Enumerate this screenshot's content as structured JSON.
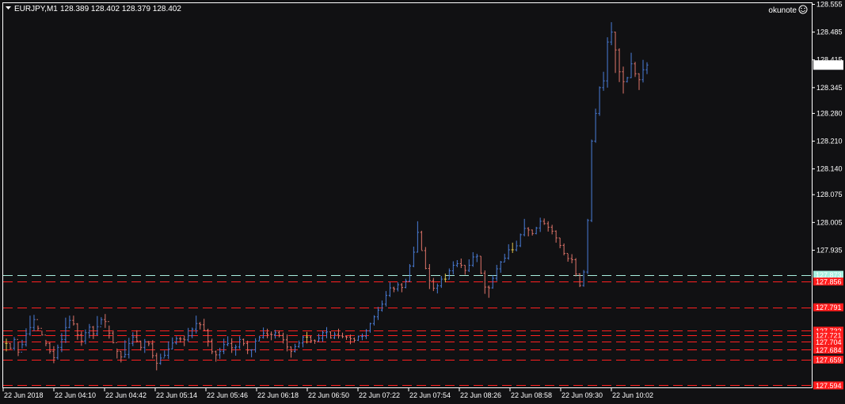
{
  "header": {
    "symbol_label": "EURJPY,M1",
    "ohlc_label": "128.389 128.402 128.379 128.402",
    "watermark": "okunote"
  },
  "colors": {
    "background": "#111113",
    "frame": "#ffffff",
    "bull": "#4a7dd8",
    "bear": "#e0756a",
    "doji": "#e0c24a",
    "level_line": "#ff2020",
    "current_line": "#a8f0e0",
    "level_label_bg": "#ff1c1c",
    "current_label_bg": "#a8f0e0",
    "price_label_bg": "#ffffff"
  },
  "chart_data": {
    "type": "candlestick",
    "symbol": "EURJPY",
    "timeframe": "M1",
    "y_range": [
      127.589,
      128.558
    ],
    "y_ticks": [
      "128.555",
      "128.485",
      "128.415",
      "128.345",
      "128.280",
      "128.210",
      "128.140",
      "128.075",
      "128.005",
      "127.935"
    ],
    "x_ticks": [
      "22 Jun 2018",
      "22 Jun 04:10",
      "22 Jun 04:42",
      "22 Jun 05:14",
      "22 Jun 05:46",
      "22 Jun 06:18",
      "22 Jun 06:50",
      "22 Jun 07:22",
      "22 Jun 07:54",
      "22 Jun 08:26",
      "22 Jun 08:58",
      "22 Jun 09:30",
      "22 Jun 10:02"
    ],
    "current_price": "128.402",
    "levels": [
      {
        "price": 127.873,
        "label": "127.873",
        "style": "current"
      },
      {
        "price": 127.856,
        "label": "127.856",
        "style": "level"
      },
      {
        "price": 127.791,
        "label": "127.791",
        "style": "level"
      },
      {
        "price": 127.732,
        "label": "127.732",
        "style": "level"
      },
      {
        "price": 127.721,
        "label": "127.721",
        "style": "level"
      },
      {
        "price": 127.704,
        "label": "127.704",
        "style": "level"
      },
      {
        "price": 127.684,
        "label": "127.684",
        "style": "level"
      },
      {
        "price": 127.659,
        "label": "127.659",
        "style": "level"
      },
      {
        "price": 127.594,
        "label": "127.594",
        "style": "level"
      }
    ],
    "closes": [
      127.7,
      127.688,
      127.71,
      127.678,
      127.697,
      127.724,
      127.74,
      127.76,
      127.738,
      127.721,
      127.7,
      127.68,
      127.664,
      127.69,
      127.71,
      127.74,
      127.758,
      127.749,
      127.722,
      127.706,
      127.727,
      127.741,
      127.724,
      127.742,
      127.76,
      127.755,
      127.726,
      127.702,
      127.68,
      127.666,
      127.672,
      127.7,
      127.716,
      127.706,
      127.69,
      127.704,
      127.699,
      127.669,
      127.65,
      127.663,
      127.67,
      127.686,
      127.701,
      127.712,
      127.711,
      127.709,
      127.719,
      127.736,
      127.75,
      127.747,
      127.733,
      127.706,
      127.679,
      127.671,
      127.68,
      127.697,
      127.7,
      127.689,
      127.691,
      127.71,
      127.7,
      127.683,
      127.684,
      127.706,
      127.715,
      127.726,
      127.723,
      127.722,
      127.727,
      127.72,
      127.709,
      127.691,
      127.68,
      127.692,
      127.701,
      127.716,
      127.716,
      127.707,
      127.706,
      127.713,
      127.727,
      127.729,
      127.714,
      127.723,
      127.719,
      127.717,
      127.716,
      127.712,
      127.708,
      127.717,
      127.718,
      127.732,
      127.75,
      127.767,
      127.784,
      127.799,
      127.821,
      127.84,
      127.837,
      127.848,
      127.841,
      127.857,
      127.895,
      127.93,
      127.98,
      127.934,
      127.889,
      127.858,
      127.839,
      127.845,
      127.862,
      127.862,
      127.883,
      127.897,
      127.901,
      127.897,
      127.884,
      127.897,
      127.918,
      127.92,
      127.877,
      127.842,
      127.84,
      127.864,
      127.888,
      127.905,
      127.915,
      127.936,
      127.936,
      127.946,
      127.974,
      127.99,
      127.986,
      127.977,
      127.991,
      128.008,
      128.002,
      127.993,
      127.983,
      127.966,
      127.947,
      127.927,
      127.914,
      127.911,
      127.875,
      127.846,
      127.88,
      128.01,
      128.21,
      128.28,
      128.345,
      128.362,
      128.46,
      128.485,
      128.44,
      128.385,
      128.36,
      128.37,
      128.405,
      128.38,
      128.365,
      128.39,
      128.402
    ],
    "highs": [
      127.712,
      127.701,
      127.716,
      127.703,
      127.709,
      127.738,
      127.77,
      127.772,
      127.745,
      127.732,
      127.709,
      127.703,
      127.693,
      127.697,
      127.726,
      127.765,
      127.77,
      127.77,
      127.751,
      127.73,
      127.735,
      127.749,
      127.744,
      127.769,
      127.766,
      127.774,
      127.745,
      127.733,
      127.687,
      127.68,
      127.708,
      127.714,
      127.728,
      127.733,
      127.706,
      127.711,
      127.706,
      127.708,
      127.676,
      127.674,
      127.682,
      127.705,
      127.715,
      127.718,
      127.717,
      127.72,
      127.739,
      127.74,
      127.77,
      127.754,
      127.762,
      127.737,
      127.712,
      127.682,
      127.689,
      127.712,
      127.718,
      127.713,
      127.697,
      127.718,
      127.712,
      127.707,
      127.685,
      127.713,
      127.719,
      127.74,
      127.737,
      127.73,
      127.734,
      127.732,
      127.727,
      127.722,
      127.692,
      127.699,
      127.707,
      127.719,
      127.729,
      127.719,
      127.71,
      127.724,
      127.732,
      127.741,
      127.73,
      127.729,
      127.737,
      127.727,
      127.719,
      127.722,
      127.715,
      127.72,
      127.725,
      127.736,
      127.752,
      127.771,
      127.792,
      127.808,
      127.832,
      127.854,
      127.843,
      127.854,
      127.852,
      127.863,
      127.9,
      127.944,
      128.008,
      127.984,
      127.943,
      127.9,
      127.865,
      127.851,
      127.87,
      127.876,
      127.889,
      127.907,
      127.91,
      127.914,
      127.897,
      127.912,
      127.93,
      127.926,
      127.92,
      127.884,
      127.846,
      127.872,
      127.898,
      127.908,
      127.926,
      127.95,
      127.954,
      127.959,
      127.977,
      128.014,
      127.993,
      127.987,
      127.994,
      128.017,
      128.015,
      128.008,
      127.999,
      127.985,
      127.966,
      127.952,
      127.926,
      127.925,
      127.915,
      127.877,
      127.885,
      128.014,
      128.214,
      128.292,
      128.348,
      128.385,
      128.472,
      128.51,
      128.486,
      128.444,
      128.398,
      128.372,
      128.433,
      128.41,
      128.381,
      128.415,
      128.409
    ],
    "lows": [
      127.68,
      127.685,
      127.682,
      127.668,
      127.687,
      127.692,
      127.719,
      127.731,
      127.732,
      127.72,
      127.693,
      127.674,
      127.65,
      127.659,
      127.678,
      127.701,
      127.738,
      127.745,
      127.709,
      127.694,
      127.698,
      127.713,
      127.711,
      127.72,
      127.747,
      127.739,
      127.712,
      127.7,
      127.662,
      127.652,
      127.664,
      127.662,
      127.693,
      127.702,
      127.682,
      127.676,
      127.693,
      127.662,
      127.632,
      127.646,
      127.665,
      127.661,
      127.685,
      127.697,
      127.702,
      127.693,
      127.704,
      127.713,
      127.725,
      127.735,
      127.733,
      127.692,
      127.673,
      127.654,
      127.661,
      127.673,
      127.693,
      127.676,
      127.669,
      127.686,
      127.694,
      127.673,
      127.665,
      127.677,
      127.706,
      127.712,
      127.713,
      127.708,
      127.712,
      127.715,
      127.7,
      127.68,
      127.664,
      127.677,
      127.689,
      127.69,
      127.7,
      127.701,
      127.699,
      127.704,
      127.704,
      127.713,
      127.712,
      127.711,
      127.712,
      127.713,
      127.709,
      127.698,
      127.702,
      127.706,
      127.708,
      127.711,
      127.727,
      127.745,
      127.759,
      127.78,
      127.793,
      127.817,
      127.829,
      127.831,
      127.829,
      127.839,
      127.855,
      127.892,
      127.929,
      127.935,
      127.887,
      127.837,
      127.832,
      127.826,
      127.84,
      127.854,
      127.861,
      127.874,
      127.892,
      127.89,
      127.873,
      127.88,
      127.893,
      127.905,
      127.875,
      127.825,
      127.815,
      127.838,
      127.857,
      127.878,
      127.905,
      127.911,
      127.928,
      127.932,
      127.943,
      127.97,
      127.97,
      127.972,
      127.975,
      127.981,
      127.999,
      127.982,
      127.975,
      127.954,
      127.94,
      127.922,
      127.906,
      127.902,
      127.869,
      127.842,
      127.843,
      127.875,
      128.006,
      128.206,
      128.274,
      128.337,
      128.345,
      128.452,
      128.382,
      128.359,
      128.33,
      128.358,
      128.369,
      128.372,
      128.339,
      128.358,
      128.379
    ]
  }
}
